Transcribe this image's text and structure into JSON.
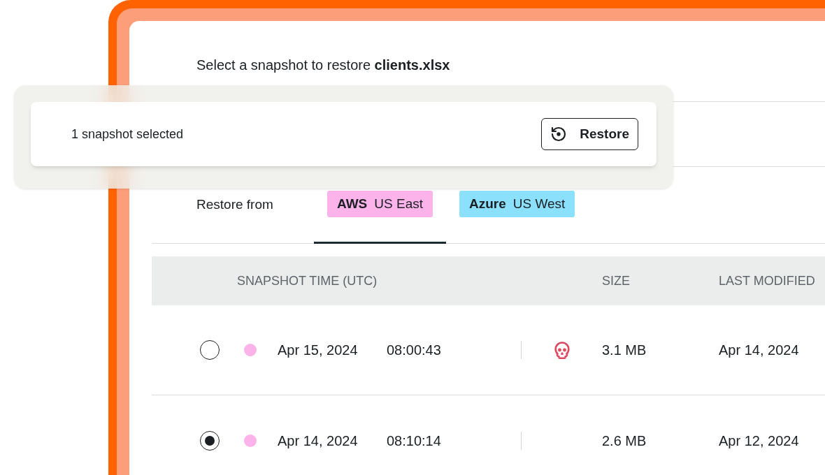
{
  "prompt": {
    "text": "Select a snapshot to restore **clients.xlsx**"
  },
  "selection_bar": {
    "count_text": "1 snapshot selected",
    "button": "Restore"
  },
  "restore_from": {
    "label": "Restore from",
    "tabs": [
      {
        "provider": "AWS",
        "region": "US East",
        "color": "#fbb3ea",
        "selected": true
      },
      {
        "provider": "Azure",
        "region": "US West",
        "color": "#8be0fb",
        "selected": false
      }
    ]
  },
  "table": {
    "columns": [
      "SNAPSHOT TIME (UTC)",
      "SIZE",
      "LAST MODIFIED"
    ],
    "rows": [
      {
        "selected": false,
        "color": "#fbb3ea",
        "date": "Apr 15, 2024",
        "time": "08:00:43",
        "flagged": true,
        "size": "3.1 MB",
        "modified": "Apr 14, 2024"
      },
      {
        "selected": true,
        "color": "#fbb3ea",
        "date": "Apr 14, 2024",
        "time": "08:10:14",
        "flagged": false,
        "size": "2.6 MB",
        "modified": "Apr 12, 2024"
      }
    ]
  }
}
